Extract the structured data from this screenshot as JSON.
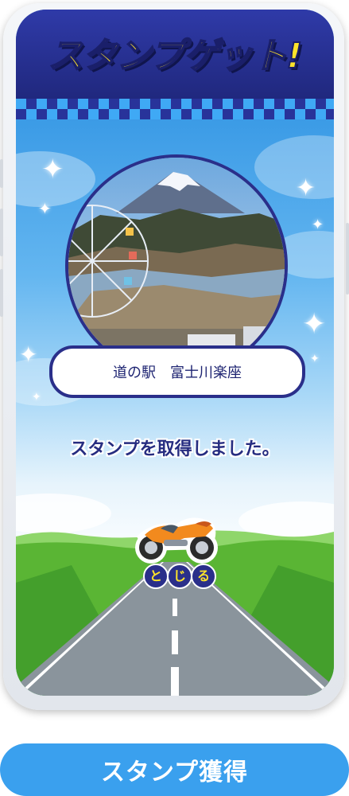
{
  "header": {
    "title": "スタンプゲット!"
  },
  "stamp": {
    "photo_alt": "富士山と川の風景写真",
    "location_name": "道の駅　富士川楽座"
  },
  "message": "スタンプを取得しました。",
  "close_button": {
    "chars": [
      "と",
      "じ",
      "る"
    ]
  },
  "bottom_button": {
    "label": "スタンプ獲得"
  },
  "colors": {
    "header_navy": "#24307f",
    "title_yellow": "#fde32a",
    "sky_blue": "#5aaeee",
    "button_blue": "#3aa0ee",
    "text_navy": "#262c80"
  }
}
